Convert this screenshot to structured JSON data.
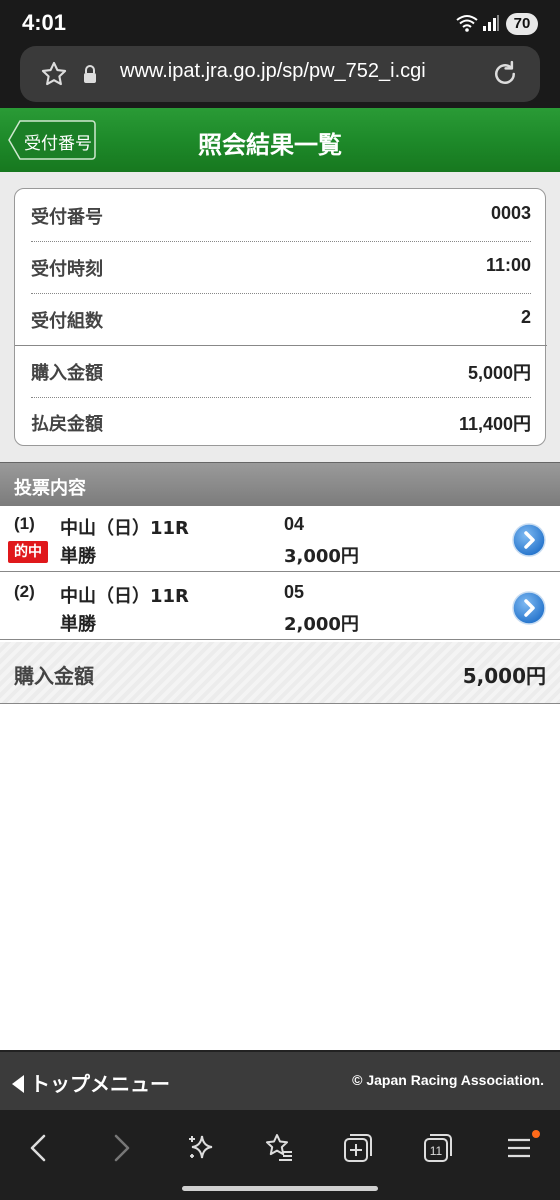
{
  "status": {
    "time": "4:01",
    "battery": "70"
  },
  "browser": {
    "url": "www.ipat.jra.go.jp/sp/pw_752_i.cgi",
    "tab_count": "11"
  },
  "header": {
    "back_label": "受付番号",
    "title": "照会結果一覧"
  },
  "summary": [
    {
      "label": "受付番号",
      "value": "0003"
    },
    {
      "label": "受付時刻",
      "value": "11:00"
    },
    {
      "label": "受付組数",
      "value": "2"
    },
    {
      "label": "購入金額",
      "value": "5,000円"
    },
    {
      "label": "払戻金額",
      "value": "11,400円"
    }
  ],
  "section_title": "投票内容",
  "tickets": [
    {
      "index": "(1)",
      "badge": "的中",
      "race": "中山（日）11R",
      "bet_type": "単勝",
      "horse": "04",
      "amount": "3,000円"
    },
    {
      "index": "(2)",
      "badge": "",
      "race": "中山（日）11R",
      "bet_type": "単勝",
      "horse": "05",
      "amount": "2,000円"
    }
  ],
  "total": {
    "label": "購入金額",
    "value": "5,000円"
  },
  "footer": {
    "top_menu": "トップメニュー",
    "copyright": "© Japan Racing Association."
  },
  "colors": {
    "header_green": "#1e8a2a",
    "hit_red": "#e0181b",
    "arrow_blue": "#2f7fd6",
    "notify_orange": "#ff6a1a"
  }
}
